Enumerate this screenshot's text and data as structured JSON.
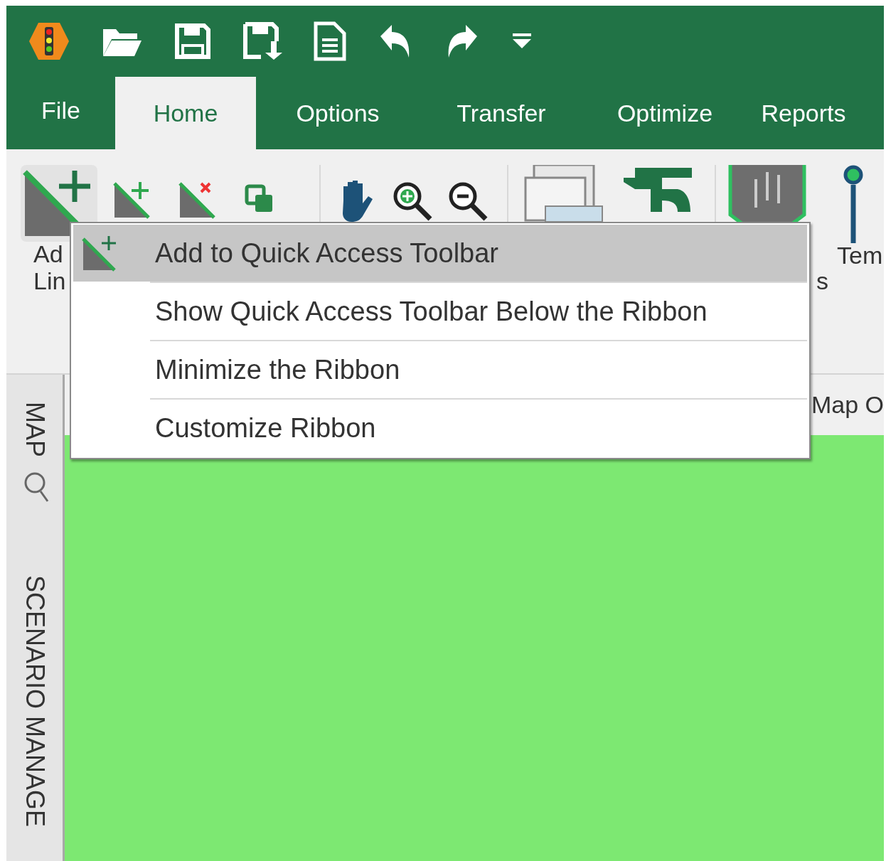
{
  "tabs": [
    {
      "label": "File",
      "selected": false
    },
    {
      "label": "Home",
      "selected": true
    },
    {
      "label": "Options",
      "selected": false
    },
    {
      "label": "Transfer",
      "selected": false
    },
    {
      "label": "Optimize",
      "selected": false
    },
    {
      "label": "Reports",
      "selected": false
    }
  ],
  "ribbon": {
    "labels": [
      {
        "lines": [
          "Ad",
          "Lin"
        ]
      },
      {
        "lines": [
          "s"
        ]
      },
      {
        "lines": [
          "Tem"
        ]
      }
    ]
  },
  "side_tabs": [
    {
      "label": "MAP"
    },
    {
      "label": "SCENARIO MANAGE"
    }
  ],
  "map_header": {
    "text": "Map O"
  },
  "context_menu": {
    "items": [
      {
        "label": "Add to Quick Access Toolbar",
        "selected": true
      },
      {
        "label": "Show Quick Access Toolbar Below the Ribbon",
        "selected": false
      },
      {
        "label": "Minimize the Ribbon",
        "selected": false
      },
      {
        "label": "Customize Ribbon",
        "selected": false
      }
    ]
  }
}
